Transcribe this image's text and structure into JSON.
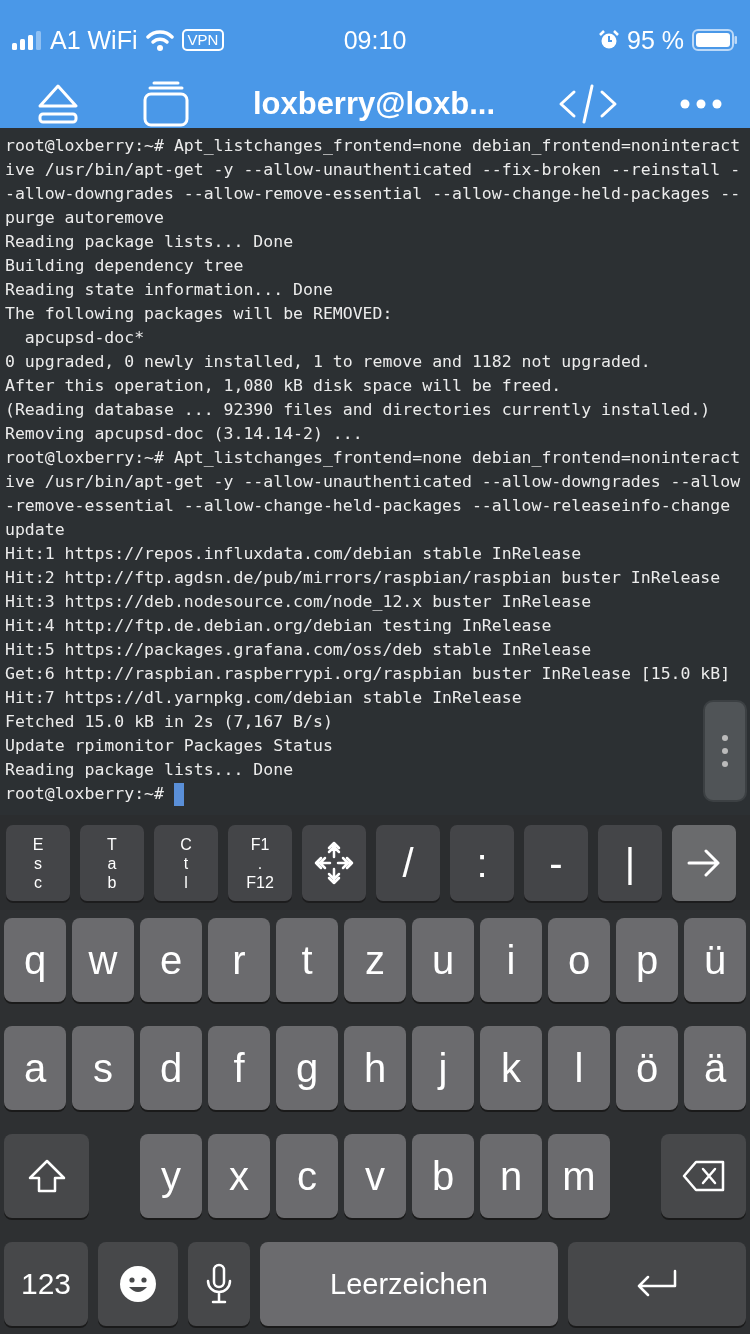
{
  "status_bar": {
    "carrier": "A1 WiFi",
    "vpn": "VPN",
    "time": "09:10",
    "battery": "95 %"
  },
  "header": {
    "title": "loxberry@loxb..."
  },
  "terminal": {
    "lines": [
      "root@loxberry:~# Apt_listchanges_frontend=none debian_frontend=noninteract",
      "ive /usr/bin/apt-get -y --allow-unauthenticated --fix-broken --reinstall -",
      "-allow-downgrades --allow-remove-essential --allow-change-held-packages --",
      "purge autoremove",
      "Reading package lists... Done",
      "Building dependency tree",
      "Reading state information... Done",
      "The following packages will be REMOVED:",
      "  apcupsd-doc*",
      "0 upgraded, 0 newly installed, 1 to remove and 1182 not upgraded.",
      "After this operation, 1,080 kB disk space will be freed.",
      "(Reading database ... 92390 files and directories currently installed.)",
      "Removing apcupsd-doc (3.14.14-2) ...",
      "root@loxberry:~# Apt_listchanges_frontend=none debian_frontend=noninteract",
      "ive /usr/bin/apt-get -y --allow-unauthenticated --allow-downgrades --allow",
      "-remove-essential --allow-change-held-packages --allow-releaseinfo-change",
      "update",
      "Hit:1 https://repos.influxdata.com/debian stable InRelease",
      "Hit:2 http://ftp.agdsn.de/pub/mirrors/raspbian/raspbian buster InRelease",
      "Hit:3 https://deb.nodesource.com/node_12.x buster InRelease",
      "Hit:4 http://ftp.de.debian.org/debian testing InRelease",
      "Hit:5 https://packages.grafana.com/oss/deb stable InRelease",
      "Get:6 http://raspbian.raspberrypi.org/raspbian buster InRelease [15.0 kB]",
      "Hit:7 https://dl.yarnpkg.com/debian stable InRelease",
      "Fetched 15.0 kB in 2s (7,167 B/s)",
      "Update rpimonitor Packages Status",
      "Reading package lists... Done"
    ],
    "prompt": "root@loxberry:~#"
  },
  "accessory_keys": [
    {
      "kind": "vertical",
      "label": "Esc"
    },
    {
      "kind": "vertical",
      "label": "Tab"
    },
    {
      "kind": "vertical",
      "label": "Ctl"
    },
    {
      "kind": "stack",
      "lines": [
        "F1",
        ".",
        "F12"
      ]
    },
    {
      "kind": "arrows"
    },
    {
      "kind": "text",
      "label": "/"
    },
    {
      "kind": "text",
      "label": ":"
    },
    {
      "kind": "text",
      "label": "-"
    },
    {
      "kind": "text",
      "label": "|"
    },
    {
      "kind": "arrow"
    }
  ],
  "keyboard": {
    "rows": [
      {
        "keys": [
          {
            "kind": "letter",
            "label": "q"
          },
          {
            "kind": "letter",
            "label": "w"
          },
          {
            "kind": "letter",
            "label": "e"
          },
          {
            "kind": "letter",
            "label": "r"
          },
          {
            "kind": "letter",
            "label": "t"
          },
          {
            "kind": "letter",
            "label": "z"
          },
          {
            "kind": "letter",
            "label": "u"
          },
          {
            "kind": "letter",
            "label": "i"
          },
          {
            "kind": "letter",
            "label": "o"
          },
          {
            "kind": "letter",
            "label": "p"
          },
          {
            "kind": "letter",
            "label": "ü"
          }
        ]
      },
      {
        "keys": [
          {
            "kind": "letter",
            "label": "a"
          },
          {
            "kind": "letter",
            "label": "s"
          },
          {
            "kind": "letter",
            "label": "d"
          },
          {
            "kind": "letter",
            "label": "f"
          },
          {
            "kind": "letter",
            "label": "g"
          },
          {
            "kind": "letter",
            "label": "h"
          },
          {
            "kind": "letter",
            "label": "j"
          },
          {
            "kind": "letter",
            "label": "k"
          },
          {
            "kind": "letter",
            "label": "l"
          },
          {
            "kind": "letter",
            "label": "ö"
          },
          {
            "kind": "letter",
            "label": "ä"
          }
        ]
      },
      {
        "keys": [
          {
            "kind": "shift"
          },
          {
            "kind": "letter",
            "label": "y"
          },
          {
            "kind": "letter",
            "label": "x"
          },
          {
            "kind": "letter",
            "label": "c"
          },
          {
            "kind": "letter",
            "label": "v"
          },
          {
            "kind": "letter",
            "label": "b"
          },
          {
            "kind": "letter",
            "label": "n"
          },
          {
            "kind": "letter",
            "label": "m"
          },
          {
            "kind": "backspace"
          }
        ]
      },
      {
        "keys": [
          {
            "kind": "numbers",
            "label": "123"
          },
          {
            "kind": "emoji"
          },
          {
            "kind": "mic"
          },
          {
            "kind": "space",
            "label": "Leerzeichen"
          },
          {
            "kind": "return"
          }
        ]
      }
    ]
  }
}
